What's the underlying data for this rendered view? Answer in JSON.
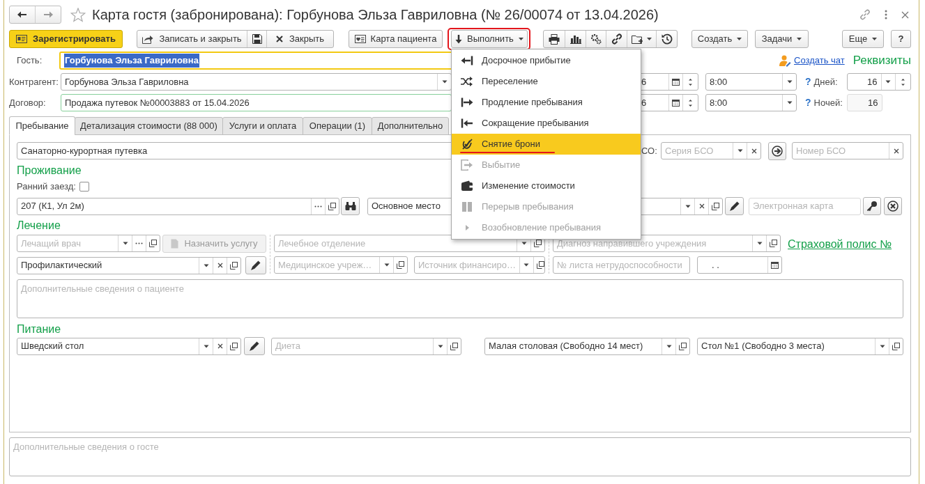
{
  "window": {
    "title": "Карта гостя (забронирована): Горбунова Эльза Гавриловна (№ 26/00074 от 13.04.2026)"
  },
  "toolbar": {
    "register": "Зарегистрировать",
    "save_close": "Записать и закрыть",
    "close": "Закрыть",
    "patient_card": "Карта пациента",
    "execute": "Выполнить",
    "create": "Создать",
    "tasks": "Задачи",
    "more": "Еще",
    "help": "?"
  },
  "execute_menu": {
    "expanded": true,
    "items": [
      {
        "kind": "arrive",
        "label": "Досрочное прибытие",
        "disabled": false,
        "selected": false
      },
      {
        "kind": "move",
        "label": "Переселение",
        "disabled": false,
        "selected": false
      },
      {
        "kind": "extend",
        "label": "Продление пребывания",
        "disabled": false,
        "selected": false
      },
      {
        "kind": "shorten",
        "label": "Сокращение пребывания",
        "disabled": false,
        "selected": false
      },
      {
        "kind": "cancel",
        "label": "Снятие брони",
        "disabled": false,
        "selected": true
      },
      {
        "kind": "depart",
        "label": "Выбытие",
        "disabled": true,
        "selected": false
      },
      {
        "kind": "cost",
        "label": "Изменение стоимости",
        "disabled": false,
        "selected": false
      },
      {
        "kind": "pause",
        "label": "Перерыв пребывания",
        "disabled": true,
        "selected": false
      },
      {
        "kind": "resume",
        "label": "Возобновление пребывания",
        "disabled": true,
        "selected": false
      }
    ]
  },
  "header": {
    "guest_label": "Гость:",
    "guest": "Горбунова Эльза Гавриловна",
    "guest_focused": true,
    "create_chat": "Создать чат",
    "requisites": "Реквизиты",
    "contractor_label": "Контрагент:",
    "contractor": "Горбунова Эльза Гавриловна",
    "arrival_date": "6",
    "arrival_time": "8:00",
    "days_hint": "?",
    "days_label": "Дней:",
    "days": "16",
    "contract_label": "Договор:",
    "contract": "Продажа путевок №00003883 от 15.04.2026",
    "departure_date": "6",
    "departure_time": "8:00",
    "nights_hint": "?",
    "nights_label": "Ночей:",
    "nights": "16"
  },
  "tabs": [
    {
      "label": "Пребывание",
      "selected": true
    },
    {
      "label": "Детализация стоимости (88 000)",
      "selected": false
    },
    {
      "label": "Услуги и оплата",
      "selected": false
    },
    {
      "label": "Операции (1)",
      "selected": false
    },
    {
      "label": "Дополнительно",
      "selected": false
    }
  ],
  "stay": {
    "stay_type": "Санаторно-курортная путевка",
    "bso_label": "СО:",
    "bso_series_placeholder": "Серия БСО",
    "bso_number_placeholder": "Номер БСО",
    "living": {
      "title": "Проживание",
      "early_checkin_label": "Ранний заезд:",
      "early_checkin": false,
      "room": "207 (К1, Ул 2м)",
      "place": "Основное место",
      "card_placeholder": "Электронная карта"
    },
    "treatment": {
      "title": "Лечение",
      "doctor_placeholder": "Лечащий врач",
      "assign_button": "Назначить услугу",
      "department_placeholder": "Лечебное отделение",
      "diagnosis_placeholder": "Диагноз направившего учреждения",
      "policy_link": "Страховой полис №",
      "program": "Профилактический",
      "institution_placeholder": "Медицинское учреж…",
      "funding_placeholder": "Источник финансиро…",
      "sick_leave_placeholder": "№ листа нетрудоспособности",
      "date": ". .",
      "notes_placeholder": "Дополнительные сведения о пациенте"
    },
    "food": {
      "title": "Питание",
      "type": "Шведский стол",
      "diet_placeholder": "Диета",
      "dining": "Малая столовая (Свободно 14 мест)",
      "table": "Стол №1 (Свободно 3 места)"
    }
  },
  "guest_notes_placeholder": "Дополнительные сведения о госте"
}
